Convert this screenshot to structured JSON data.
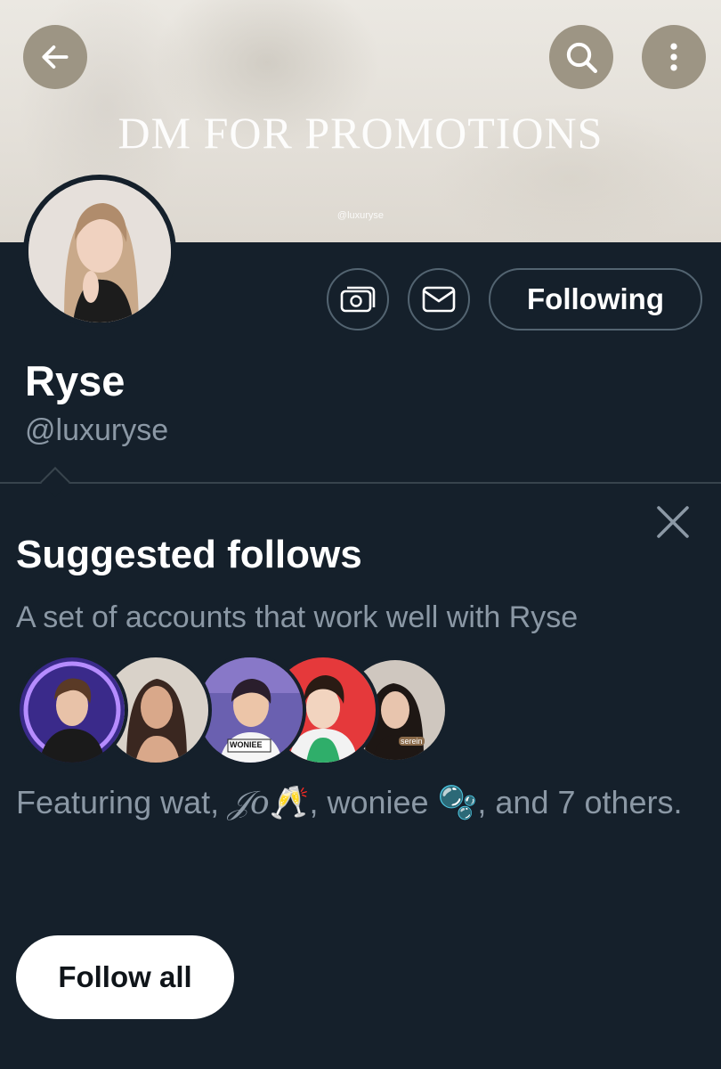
{
  "banner": {
    "title": "DM FOR PROMOTIONS",
    "watermark": "@luxuryse"
  },
  "header_actions": {
    "back_icon": "arrow-left-icon",
    "search_icon": "search-icon",
    "more_icon": "more-vertical-icon"
  },
  "profile": {
    "display_name": "Ryse",
    "handle": "@luxuryse",
    "tip_icon": "money-icon",
    "message_icon": "envelope-icon",
    "follow_button_label": "Following"
  },
  "suggested": {
    "title": "Suggested follows",
    "subtitle": "A set of accounts that work well with Ryse",
    "avatar_labels": [
      "WONIEE",
      "serein"
    ],
    "featuring_prefix": "Featuring wat, ",
    "featuring_name_glyph": "𝒥𝑜",
    "featuring_emoji_1": "🥂",
    "featuring_middle": ", woniee ",
    "featuring_emoji_2": "🫧",
    "featuring_suffix": ", and 7 others.",
    "follow_all_label": "Follow all",
    "close_icon": "close-icon"
  },
  "colors": {
    "background": "#15202b",
    "secondary_text": "#8b98a5",
    "border": "#536471",
    "banner_button": "#9d9584"
  }
}
